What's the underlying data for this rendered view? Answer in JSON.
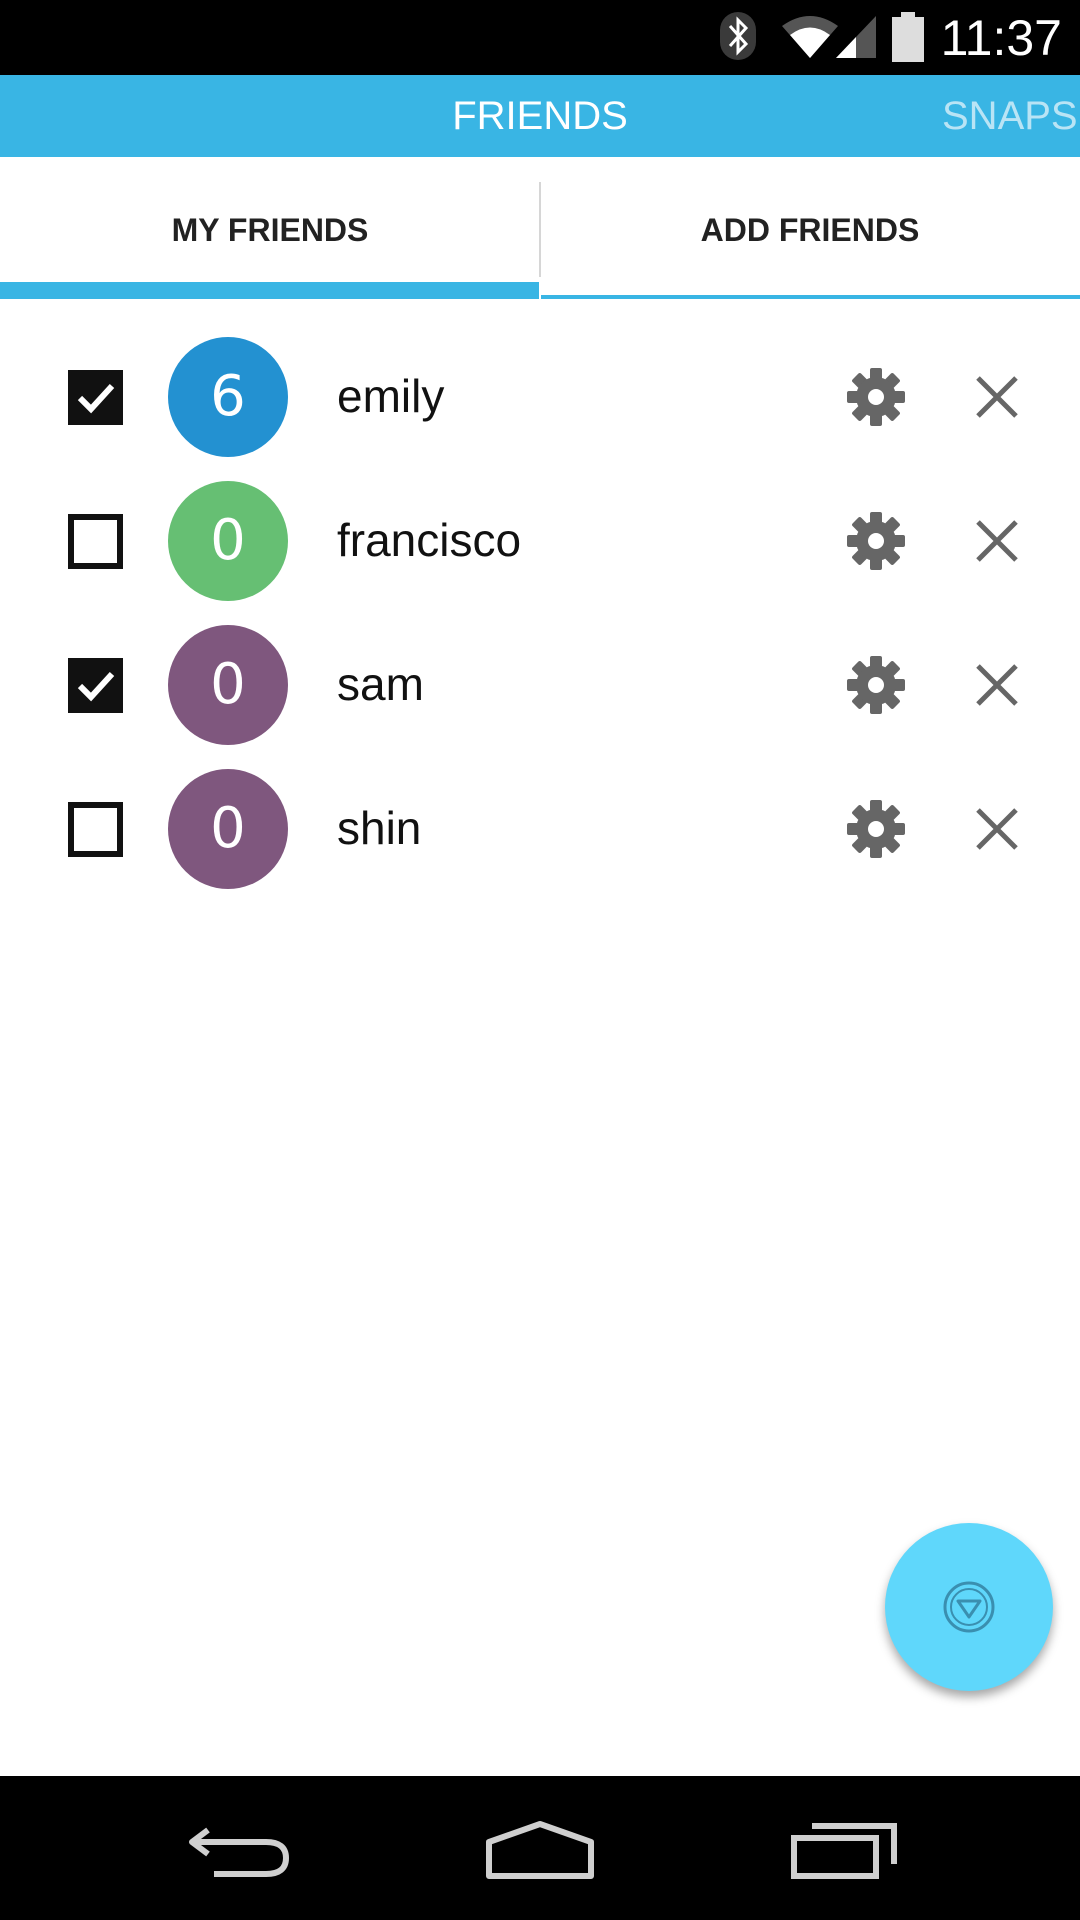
{
  "status_bar": {
    "time": "11:37",
    "icons": [
      "bluetooth-icon",
      "wifi-icon",
      "cell-signal-icon",
      "battery-icon"
    ]
  },
  "top_bar": {
    "active_title": "FRIENDS",
    "next_title": "SNAPS",
    "color": "#39b5e4"
  },
  "tabs": [
    {
      "label": "MY FRIENDS",
      "selected": true
    },
    {
      "label": "ADD FRIENDS",
      "selected": false
    }
  ],
  "friends": [
    {
      "name": "emily",
      "count": "6",
      "checked": true,
      "color": "#2391d1"
    },
    {
      "name": "francisco",
      "count": "0",
      "checked": false,
      "color": "#66bf73"
    },
    {
      "name": "sam",
      "count": "0",
      "checked": true,
      "color": "#7f577e"
    },
    {
      "name": "shin",
      "count": "0",
      "checked": false,
      "color": "#7f577e"
    }
  ],
  "row_icons": [
    "gear-icon",
    "close-icon"
  ],
  "fab": {
    "icon": "circle-down-arrow-icon",
    "color": "#5fd7fb"
  },
  "nav_bar": {
    "icons": [
      "back-icon",
      "home-icon",
      "recent-apps-icon"
    ]
  }
}
